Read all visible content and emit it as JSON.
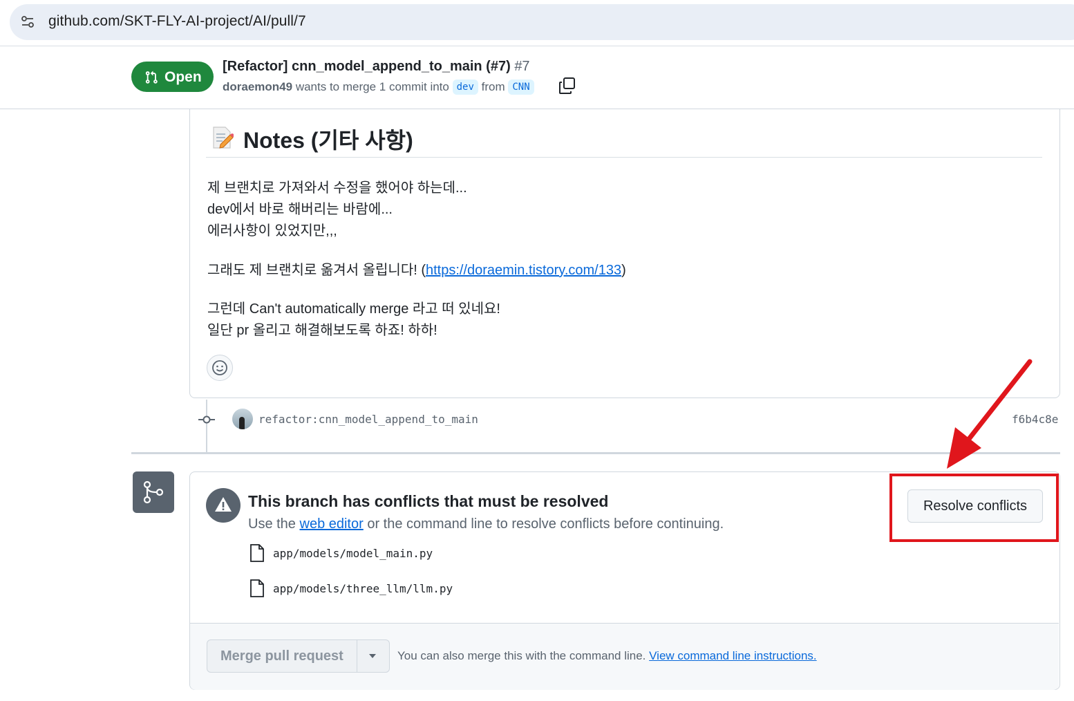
{
  "browser": {
    "url_host": "github.com",
    "url_path": "/SKT-FLY-AI-project/AI/pull/7",
    "site_icon": "tune-icon"
  },
  "pr": {
    "state": "Open",
    "title": "[Refactor] cnn_model_append_to_main (#7)",
    "number": "#7",
    "author": "doraemon49",
    "merge_text_1": "wants to merge 1 commit into",
    "base_branch": "dev",
    "merge_text_2": "from",
    "head_branch": "CNN"
  },
  "comment": {
    "heading": "Notes (기타 사항)",
    "lines": [
      "제 브랜치로 가져와서 수정을 했어야 하는데...",
      "dev에서 바로 해버리는 바람에...",
      "에러사항이 있었지만,,,",
      "그래도 제 브랜치로 옮겨서 올립니다! (",
      "https://doraemin.tistory.com/133",
      ")",
      "그런데 Can't automatically merge 라고 떠 있네요!",
      "일단 pr 올리고 해결해보도록 하죠! 하하!"
    ]
  },
  "commit": {
    "message": "refactor:cnn_model_append_to_main",
    "sha": "f6b4c8e"
  },
  "merge": {
    "conflict_title": "This branch has conflicts that must be resolved",
    "sub_prefix": "Use the",
    "web_editor_link": "web editor",
    "sub_suffix": "or the command line to resolve conflicts before continuing.",
    "files": [
      "app/models/model_main.py",
      "app/models/three_llm/llm.py"
    ],
    "resolve_button": "Resolve conflicts",
    "merge_button": "Merge pull request",
    "hint_text": "You can also merge this with the command line.",
    "hint_link": "View command line instructions."
  },
  "colors": {
    "open_green": "#1f883d",
    "link_blue": "#0969da",
    "highlight_red": "#e0161c"
  }
}
